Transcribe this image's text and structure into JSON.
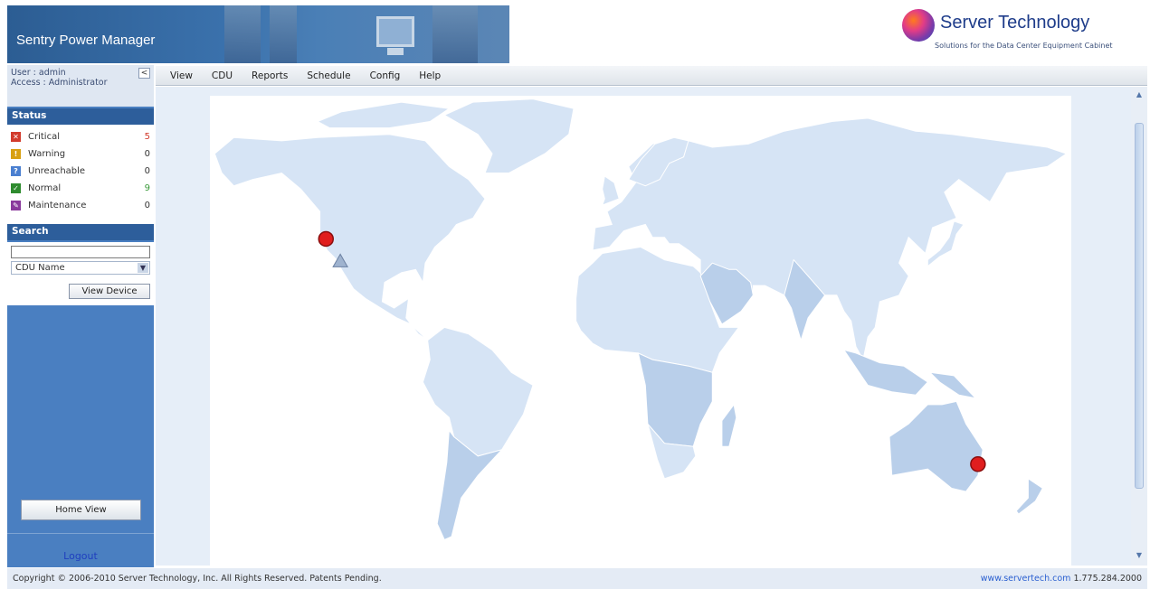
{
  "app": {
    "title": "Sentry Power Manager",
    "brand_name": "Server Technology",
    "brand_tagline": "Solutions for the Data Center Equipment Cabinet",
    "brand_color": "#1e3c8a"
  },
  "user": {
    "user_line": "User : admin",
    "access_line": "Access : Administrator",
    "collapse_glyph": "<"
  },
  "menu": {
    "items": [
      {
        "label": "View"
      },
      {
        "label": "CDU"
      },
      {
        "label": "Reports"
      },
      {
        "label": "Schedule"
      },
      {
        "label": "Config"
      },
      {
        "label": "Help"
      }
    ]
  },
  "status": {
    "heading": "Status",
    "items": [
      {
        "label": "Critical",
        "count": "5",
        "icon": "critical-icon",
        "color": "#d23b2c",
        "count_color": "#d23b2c",
        "glyph": "✕"
      },
      {
        "label": "Warning",
        "count": "0",
        "icon": "warning-icon",
        "color": "#d8a011",
        "count_color": "#333333",
        "glyph": "!"
      },
      {
        "label": "Unreachable",
        "count": "0",
        "icon": "unreachable-icon",
        "color": "#4a7fd0",
        "count_color": "#333333",
        "glyph": "?"
      },
      {
        "label": "Normal",
        "count": "9",
        "icon": "normal-icon",
        "color": "#2e8b2e",
        "count_color": "#3a9a3a",
        "glyph": "✓"
      },
      {
        "label": "Maintenance",
        "count": "0",
        "icon": "maintenance-icon",
        "color": "#8a3a9c",
        "count_color": "#333333",
        "glyph": "✎"
      }
    ]
  },
  "search": {
    "heading": "Search",
    "input_value": "",
    "select_value": "CDU Name",
    "view_device_label": "View Device"
  },
  "sidebar": {
    "home_view_label": "Home View",
    "logout_label": "Logout"
  },
  "map": {
    "markers": [
      {
        "name": "critical-marker-us-west",
        "status": "critical",
        "lon": -121.5,
        "lat": 39.5
      },
      {
        "name": "unreachable-marker-us-southwest",
        "status": "unreachable",
        "lon": -115.5,
        "lat": 32.5
      },
      {
        "name": "critical-marker-australia-east",
        "status": "critical",
        "lon": 151.0,
        "lat": -30.5
      }
    ],
    "land_color": "#d6e4f5",
    "region_color": "#b9cfea"
  },
  "footer": {
    "copyright": "Copyright © 2006-2010 Server Technology, Inc. All Rights Reserved. Patents Pending.",
    "website": "www.servertech.com",
    "phone": "1.775.284.2000"
  }
}
